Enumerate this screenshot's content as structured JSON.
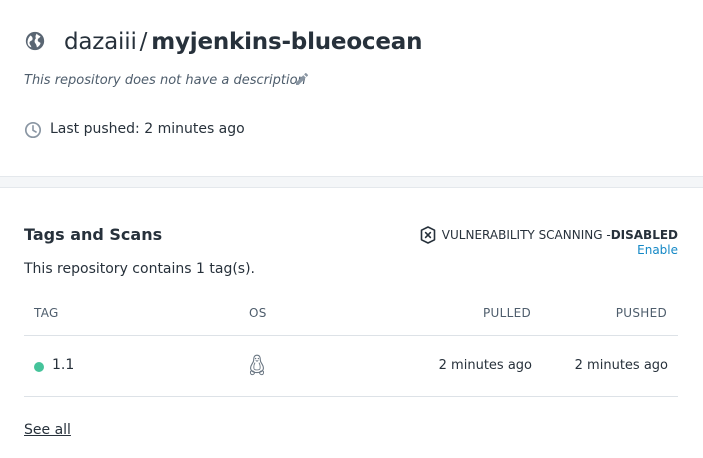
{
  "repository": {
    "namespace": "dazaiii",
    "separator": "/",
    "name": "myjenkins-blueocean",
    "description": "This repository does not have a description",
    "last_pushed": "Last pushed: 2 minutes ago"
  },
  "tags_section": {
    "title": "Tags and Scans",
    "vulnerability_label": "VULNERABILITY SCANNING - ",
    "vulnerability_status": "DISABLED",
    "enable_label": "Enable",
    "summary": "This repository contains 1 tag(s).",
    "columns": [
      "TAG",
      "OS",
      "PULLED",
      "PUSHED"
    ],
    "rows": [
      {
        "tag": "1.1",
        "os": "linux-icon",
        "pulled": "2 minutes ago",
        "pushed": "2 minutes ago",
        "status_color": "#45c39a"
      }
    ],
    "see_all_label": "See all"
  },
  "icons": [
    "globe-icon",
    "pencil-icon",
    "clock-icon",
    "shield-x-icon",
    "linux-icon"
  ],
  "colors": {
    "link": "#1488c6",
    "text": "#27313b",
    "muted": "#4e5d6c",
    "status_active": "#45c39a"
  }
}
